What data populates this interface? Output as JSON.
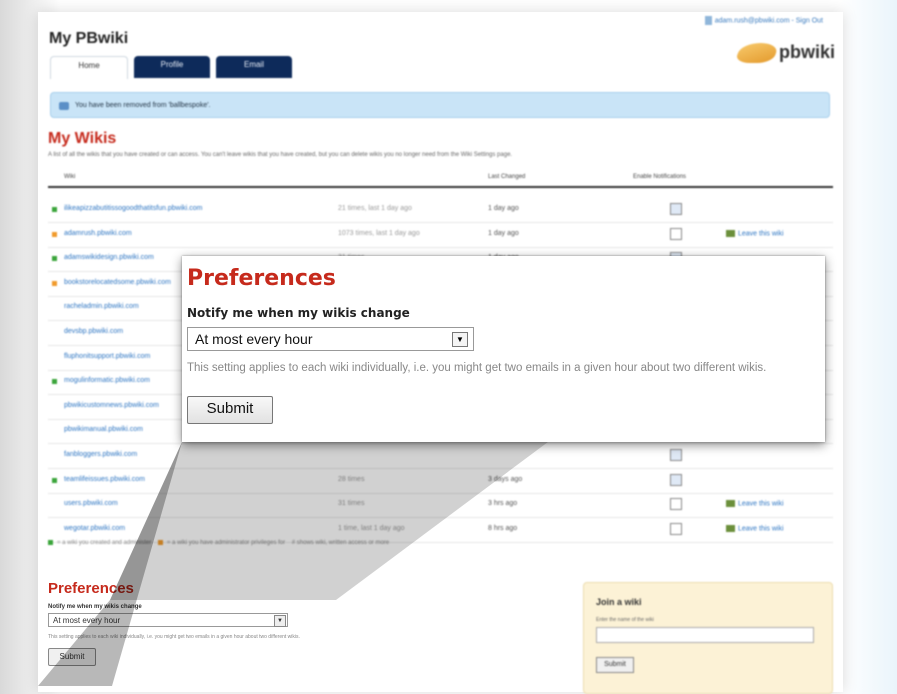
{
  "header": {
    "site_title": "My PBwiki",
    "user_line": "adam.rush@pbwiki.com - Sign Out",
    "brand": "pbwiki"
  },
  "tabs": [
    {
      "label": "Home"
    },
    {
      "label": "Profile"
    },
    {
      "label": "Email"
    }
  ],
  "notice": {
    "text": "You have been removed from 'ballbespoke'."
  },
  "wikis": {
    "title": "My Wikis",
    "description": "A list of all the wikis that you have created or can access. You can't leave wikis that you have created, but you can delete wikis you no longer need from the Wiki Settings page.",
    "columns": [
      "Wiki",
      "Last Changed",
      "Enable Notifications"
    ],
    "rows": [
      {
        "dot": "green",
        "name": "ilikeapizzabutitissogoodthatitsfun.pbwiki.com",
        "meta": "21 times, last 1 day ago",
        "changed": "1 day ago",
        "notify": true,
        "leave": ""
      },
      {
        "dot": "orange",
        "name": "adamrush.pbwiki.com",
        "meta": "1073 times, last 1 day ago",
        "changed": "1 day ago",
        "notify": false,
        "leave": "Leave this wiki"
      },
      {
        "dot": "green",
        "name": "adamswikidesign.pbwiki.com",
        "meta": "31 times",
        "changed": "1 day ago",
        "notify": true,
        "leave": ""
      },
      {
        "dot": "orange",
        "name": "bookstorelocatedsome.pbwiki.com",
        "meta": "",
        "changed": "",
        "notify": false,
        "leave": ""
      },
      {
        "dot": "none",
        "name": "racheladmin.pbwiki.com",
        "meta": "",
        "changed": "",
        "notify": false,
        "leave": ""
      },
      {
        "dot": "none",
        "name": "devsbp.pbwiki.com",
        "meta": "",
        "changed": "",
        "notify": false,
        "leave": ""
      },
      {
        "dot": "none",
        "name": "fluphonitsupport.pbwiki.com",
        "meta": "",
        "changed": "",
        "notify": false,
        "leave": ""
      },
      {
        "dot": "green",
        "name": "mogulinformatic.pbwiki.com",
        "meta": "",
        "changed": "",
        "notify": false,
        "leave": ""
      },
      {
        "dot": "none",
        "name": "pbwikicustomnews.pbwiki.com",
        "meta": "",
        "changed": "",
        "notify": false,
        "leave": ""
      },
      {
        "dot": "none",
        "name": "pbwikimanual.pbwiki.com",
        "meta": "",
        "changed": "",
        "notify": false,
        "leave": ""
      },
      {
        "dot": "none",
        "name": "fanbloggers.pbwiki.com",
        "meta": "",
        "changed": "",
        "notify": true,
        "leave": ""
      },
      {
        "dot": "green",
        "name": "teamlifeissues.pbwiki.com",
        "meta": "28 times",
        "changed": "3 days ago",
        "notify": true,
        "leave": ""
      },
      {
        "dot": "none",
        "name": "users.pbwiki.com",
        "meta": "31 times",
        "changed": "3 hrs ago",
        "notify": false,
        "leave": "Leave this wiki"
      },
      {
        "dot": "none",
        "name": "wegotar.pbwiki.com",
        "meta": "1 time, last 1 day ago",
        "changed": "8 hrs ago",
        "notify": false,
        "leave": "Leave this wiki"
      }
    ],
    "legend": [
      {
        "color": "green",
        "text": "= a wiki you created and administer"
      },
      {
        "color": "orange",
        "text": "= a wiki you have administrator privileges for"
      },
      {
        "color": "none",
        "text": "# shows wiki, written access or more"
      }
    ]
  },
  "preferences": {
    "title": "Preferences",
    "label": "Notify me when my wikis change",
    "selected": "At most every hour",
    "help": "This setting applies to each wiki individually, i.e. you might get two emails in a given hour about two different wikis.",
    "submit": "Submit"
  },
  "join": {
    "title": "Join a wiki",
    "label": "Enter the name of the wiki",
    "submit": "Submit"
  },
  "colors": {
    "accent_red": "#c62a1c",
    "tab_dark": "#0d2a5a",
    "link_blue": "#2d75c2",
    "notice_bg": "#c9e4f7"
  }
}
